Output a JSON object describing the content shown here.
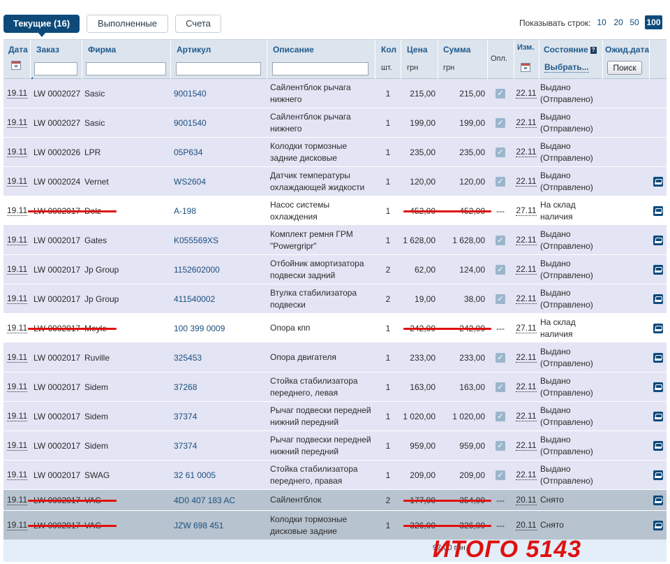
{
  "tabs": [
    {
      "label": "Текущие (16)",
      "active": true
    },
    {
      "label": "Выполненные",
      "active": false
    },
    {
      "label": "Счета",
      "active": false
    }
  ],
  "rows_per_page": {
    "label": "Показывать строк:",
    "options": [
      "10",
      "20",
      "50",
      "100"
    ],
    "selected": "100"
  },
  "header": {
    "date": "Дата",
    "order": "Заказ",
    "firm": "Фирма",
    "article": "Артикул",
    "description": "Описание",
    "qty": "Кол",
    "qty_unit": "шт.",
    "price": "Цена",
    "price_unit": "грн",
    "sum": "Сумма",
    "sum_unit": "грн",
    "paid": "Опл.",
    "changed": "Изм.",
    "status": "Состояние",
    "status_select": "Выбрать...",
    "expected": "Ожид.дата",
    "search_button": "Поиск"
  },
  "rows": [
    {
      "date": "19.11",
      "order": "LW 0002027",
      "firm": "Sasic",
      "article": "9001540",
      "desc": "Сайлентблок рычага нижнего",
      "qty": "1",
      "price": "215,00",
      "sum": "215,00",
      "paid": "check",
      "changed": "22.11",
      "status": "Выдано (Отправлено)",
      "state": "done",
      "car": false,
      "struck_order": false,
      "struck_price": false
    },
    {
      "date": "19.11",
      "order": "LW 0002027",
      "firm": "Sasic",
      "article": "9001540",
      "desc": "Сайлентблок рычага нижнего",
      "qty": "1",
      "price": "199,00",
      "sum": "199,00",
      "paid": "check",
      "changed": "22.11",
      "status": "Выдано (Отправлено)",
      "state": "done",
      "car": false,
      "struck_order": false,
      "struck_price": false
    },
    {
      "date": "19.11",
      "order": "LW 0002026",
      "firm": "LPR",
      "article": "05P634",
      "desc": "Колодки тормозные задние дисковые",
      "qty": "1",
      "price": "235,00",
      "sum": "235,00",
      "paid": "check",
      "changed": "22.11",
      "status": "Выдано (Отправлено)",
      "state": "done",
      "car": false,
      "struck_order": false,
      "struck_price": false
    },
    {
      "date": "19.11",
      "order": "LW 0002024",
      "firm": "Vernet",
      "article": "WS2604",
      "desc": "Датчик температуры охлаждающей жидкости",
      "qty": "1",
      "price": "120,00",
      "sum": "120,00",
      "paid": "check",
      "changed": "22.11",
      "status": "Выдано (Отправлено)",
      "state": "done",
      "car": true,
      "struck_order": false,
      "struck_price": false
    },
    {
      "date": "19.11",
      "order": "LW 0002017",
      "firm": "Dolz",
      "article": "A-198",
      "desc": "Насос системы охлаждения",
      "qty": "1",
      "price": "452,00",
      "sum": "452,00",
      "paid": "---",
      "changed": "27.11",
      "status": "На склад наличия",
      "state": "pend",
      "car": true,
      "struck_order": true,
      "struck_price": true
    },
    {
      "date": "19.11",
      "order": "LW 0002017",
      "firm": "Gates",
      "article": "K055569XS",
      "desc": "Комплект ремня ГРМ \"Powergripr\"",
      "qty": "1",
      "price": "1 628,00",
      "sum": "1 628,00",
      "paid": "check",
      "changed": "22.11",
      "status": "Выдано (Отправлено)",
      "state": "done",
      "car": true,
      "struck_order": false,
      "struck_price": false
    },
    {
      "date": "19.11",
      "order": "LW 0002017",
      "firm": "Jp Group",
      "article": "1152602000",
      "desc": "Отбойник амортизатора подвески задний",
      "qty": "2",
      "price": "62,00",
      "sum": "124,00",
      "paid": "check",
      "changed": "22.11",
      "status": "Выдано (Отправлено)",
      "state": "done",
      "car": true,
      "struck_order": false,
      "struck_price": false
    },
    {
      "date": "19.11",
      "order": "LW 0002017",
      "firm": "Jp Group",
      "article": "411540002",
      "desc": "Втулка стабилизатора подвески",
      "qty": "2",
      "price": "19,00",
      "sum": "38,00",
      "paid": "check",
      "changed": "22.11",
      "status": "Выдано (Отправлено)",
      "state": "done",
      "car": true,
      "struck_order": false,
      "struck_price": false
    },
    {
      "date": "19.11",
      "order": "LW 0002017",
      "firm": "Meyle",
      "article": "100 399 0009",
      "desc": "Опора кпп",
      "qty": "1",
      "price": "242,00",
      "sum": "242,00",
      "paid": "---",
      "changed": "27.11",
      "status": "На склад наличия",
      "state": "pend",
      "car": true,
      "struck_order": true,
      "struck_price": true
    },
    {
      "date": "19.11",
      "order": "LW 0002017",
      "firm": "Ruville",
      "article": "325453",
      "desc": "Опора двигателя",
      "qty": "1",
      "price": "233,00",
      "sum": "233,00",
      "paid": "check",
      "changed": "22.11",
      "status": "Выдано (Отправлено)",
      "state": "done",
      "car": true,
      "struck_order": false,
      "struck_price": false
    },
    {
      "date": "19.11",
      "order": "LW 0002017",
      "firm": "Sidem",
      "article": "37268",
      "desc": "Стойка стабилизатора переднего, левая",
      "qty": "1",
      "price": "163,00",
      "sum": "163,00",
      "paid": "check",
      "changed": "22.11",
      "status": "Выдано (Отправлено)",
      "state": "done",
      "car": true,
      "struck_order": false,
      "struck_price": false
    },
    {
      "date": "19.11",
      "order": "LW 0002017",
      "firm": "Sidem",
      "article": "37374",
      "desc": "Рычаг подвески передней нижний передний",
      "qty": "1",
      "price": "1 020,00",
      "sum": "1 020,00",
      "paid": "check",
      "changed": "22.11",
      "status": "Выдано (Отправлено)",
      "state": "done",
      "car": true,
      "struck_order": false,
      "struck_price": false
    },
    {
      "date": "19.11",
      "order": "LW 0002017",
      "firm": "Sidem",
      "article": "37374",
      "desc": "Рычаг подвески передней нижний передний",
      "qty": "1",
      "price": "959,00",
      "sum": "959,00",
      "paid": "check",
      "changed": "22.11",
      "status": "Выдано (Отправлено)",
      "state": "done",
      "car": true,
      "struck_order": false,
      "struck_price": false
    },
    {
      "date": "19.11",
      "order": "LW 0002017",
      "firm": "SWAG",
      "article": "32 61 0005",
      "desc": "Стойка стабилизатора переднего, правая",
      "qty": "1",
      "price": "209,00",
      "sum": "209,00",
      "paid": "check",
      "changed": "22.11",
      "status": "Выдано (Отправлено)",
      "state": "done",
      "car": true,
      "struck_order": false,
      "struck_price": false
    },
    {
      "date": "19.11",
      "order": "LW 0002017",
      "firm": "VAG",
      "article": "4D0 407 183 AC",
      "desc": "Сайлентблок",
      "qty": "2",
      "price": "177,00",
      "sum": "354,00",
      "paid": "---",
      "changed": "20.11",
      "status": "Снято",
      "state": "canc",
      "car": true,
      "struck_order": true,
      "struck_price": true
    },
    {
      "date": "19.11",
      "order": "LW 0002017",
      "firm": "VAG",
      "article": "JZW 698 451",
      "desc": "Колодки тормозные дисковые задние",
      "qty": "1",
      "price": "326,00",
      "sum": "326,00",
      "paid": "---",
      "changed": "20.11",
      "status": "Снято",
      "state": "canc",
      "car": true,
      "struck_order": true,
      "struck_price": true
    }
  ],
  "footer": {
    "total_partial": "97,00 грн",
    "annotation": "ИТОГО 5143"
  },
  "colors": {
    "accent": "#0d4a7a",
    "header_bg": "#dce4ee",
    "row_done": "#e3e4f4",
    "row_cancelled": "#b7c3cf",
    "annotation": "#e01010"
  }
}
